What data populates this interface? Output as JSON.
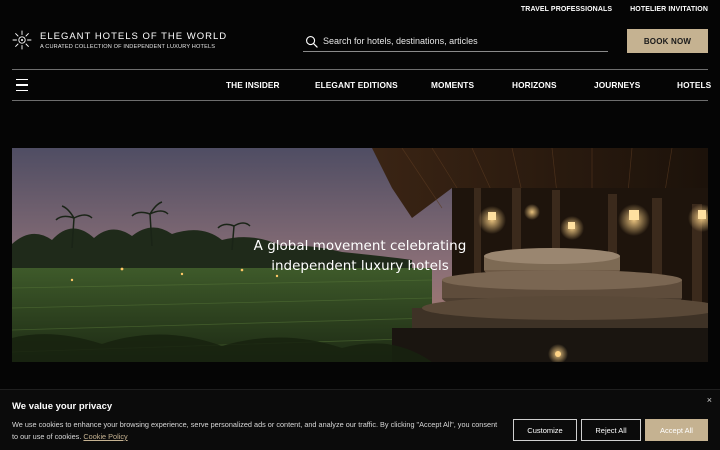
{
  "top_links": [
    "TRAVEL PROFESSIONALS",
    "HOTELIER INVITATION"
  ],
  "brand": {
    "title": "ELEGANT HOTELS OF THE WORLD",
    "subtitle": "A CURATED COLLECTION OF INDEPENDENT LUXURY HOTELS",
    "icon": "sun-logo-icon"
  },
  "search": {
    "placeholder": "Search for hotels, destinations, articles",
    "icon": "search-icon"
  },
  "book_button": "BOOK NOW",
  "nav": {
    "menu_icon": "hamburger-menu-icon",
    "items": [
      "THE INSIDER",
      "ELEGANT EDITIONS",
      "MOMENTS",
      "HORIZONS",
      "JOURNEYS",
      "HOTELS"
    ]
  },
  "hero": {
    "line1": "A global movement celebrating",
    "line2": "independent luxury hotels"
  },
  "cookie": {
    "title": "We value your privacy",
    "text": "We use cookies to enhance your browsing experience, serve personalized ads or content, and analyze our traffic. By clicking \"Accept All\", you consent to our use of cookies.",
    "link": "Cookie Policy",
    "close": "×",
    "customize": "Customize",
    "reject": "Reject All",
    "accept": "Accept All"
  },
  "colors": {
    "accent": "#c5b291",
    "background": "#050505"
  }
}
